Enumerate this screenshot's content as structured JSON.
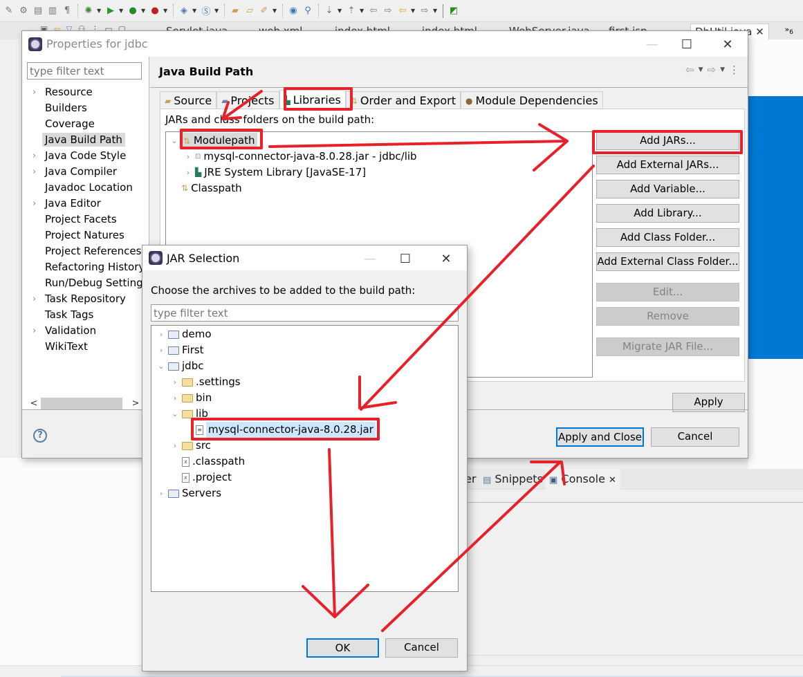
{
  "ide": {
    "editor_tabs": [
      "Servlet.java",
      "web.xml",
      "index.html",
      "index.html",
      "WebServer.java",
      "first.jsp",
      "DbUtil.java"
    ],
    "overflow_count": "6",
    "bottom_tabs": {
      "partial": "er",
      "snippets": "Snippets",
      "console": "Console"
    }
  },
  "properties_dialog": {
    "title": "Properties for jdbc",
    "filter_placeholder": "type filter text",
    "nav_items": [
      {
        "label": "Resource",
        "expandable": true
      },
      {
        "label": "Builders",
        "expandable": false
      },
      {
        "label": "Coverage",
        "expandable": false
      },
      {
        "label": "Java Build Path",
        "expandable": false,
        "selected": true
      },
      {
        "label": "Java Code Style",
        "expandable": true
      },
      {
        "label": "Java Compiler",
        "expandable": true
      },
      {
        "label": "Javadoc Location",
        "expandable": false
      },
      {
        "label": "Java Editor",
        "expandable": true
      },
      {
        "label": "Project Facets",
        "expandable": false
      },
      {
        "label": "Project Natures",
        "expandable": false
      },
      {
        "label": "Project References",
        "expandable": false
      },
      {
        "label": "Refactoring History",
        "expandable": false
      },
      {
        "label": "Run/Debug Settings",
        "expandable": false
      },
      {
        "label": "Task Repository",
        "expandable": true
      },
      {
        "label": "Task Tags",
        "expandable": false
      },
      {
        "label": "Validation",
        "expandable": true
      },
      {
        "label": "WikiText",
        "expandable": false
      }
    ],
    "page_title": "Java Build Path",
    "tabs": [
      {
        "label": "Source"
      },
      {
        "label": "Projects"
      },
      {
        "label": "Libraries",
        "active": true
      },
      {
        "label": "Order and Export"
      },
      {
        "label": "Module Dependencies"
      }
    ],
    "panel_label": "JARs and class folders on the build path:",
    "tree": {
      "modulepath": "Modulepath",
      "mysql_jar": "mysql-connector-java-8.0.28.jar - jdbc/lib",
      "jre": "JRE System Library [JavaSE-17]",
      "classpath": "Classpath"
    },
    "buttons": {
      "add_jars": "Add JARs...",
      "add_external_jars": "Add External JARs...",
      "add_variable": "Add Variable...",
      "add_library": "Add Library...",
      "add_class_folder": "Add Class Folder...",
      "add_external_class_folder": "Add External Class Folder...",
      "edit": "Edit...",
      "remove": "Remove",
      "migrate": "Migrate JAR File...",
      "apply": "Apply",
      "apply_and_close": "Apply and Close",
      "cancel": "Cancel"
    }
  },
  "jar_dialog": {
    "title": "JAR Selection",
    "prompt": "Choose the archives to be added to the build path:",
    "filter_placeholder": "type filter text",
    "tree": [
      {
        "label": "demo",
        "type": "project",
        "level": 0,
        "twisty": "collapsed"
      },
      {
        "label": "First",
        "type": "project",
        "level": 0,
        "twisty": "collapsed"
      },
      {
        "label": "jdbc",
        "type": "project",
        "level": 0,
        "twisty": "expanded"
      },
      {
        "label": ".settings",
        "type": "folder",
        "level": 1,
        "twisty": "collapsed"
      },
      {
        "label": "bin",
        "type": "folder",
        "level": 1,
        "twisty": "collapsed"
      },
      {
        "label": "lib",
        "type": "folder",
        "level": 1,
        "twisty": "expanded"
      },
      {
        "label": "mysql-connector-java-8.0.28.jar",
        "type": "jar",
        "level": 2,
        "twisty": "none",
        "selected": true
      },
      {
        "label": "src",
        "type": "folder",
        "level": 1,
        "twisty": "collapsed"
      },
      {
        "label": ".classpath",
        "type": "xml",
        "level": 1,
        "twisty": "none"
      },
      {
        "label": ".project",
        "type": "xml",
        "level": 1,
        "twisty": "none"
      },
      {
        "label": "Servers",
        "type": "project",
        "level": 0,
        "twisty": "collapsed"
      }
    ],
    "ok": "OK",
    "cancel": "Cancel"
  },
  "annotation_color": "#e8202a",
  "accent_color": "#0078d4"
}
